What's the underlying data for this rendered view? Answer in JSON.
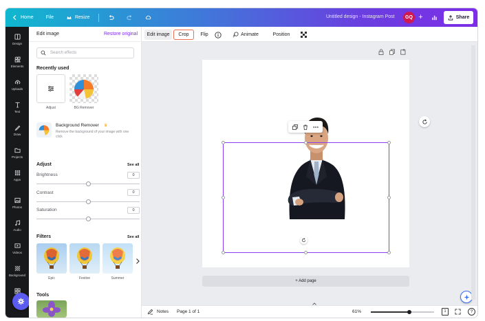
{
  "topbar": {
    "home_label": "Home",
    "file_label": "File",
    "resize_label": "Resize",
    "doc_title": "Untitled design - Instagram Post",
    "avatar_initials": "GQ",
    "share_label": "Share",
    "plus_label": "+"
  },
  "rail": {
    "items": [
      {
        "label": "Design",
        "icon": "design-icon"
      },
      {
        "label": "Elements",
        "icon": "elements-icon"
      },
      {
        "label": "Uploads",
        "icon": "uploads-icon"
      },
      {
        "label": "Text",
        "icon": "text-icon"
      },
      {
        "label": "Draw",
        "icon": "draw-icon"
      },
      {
        "label": "Projects",
        "icon": "projects-icon"
      },
      {
        "label": "Apps",
        "icon": "apps-icon"
      },
      {
        "label": "Photos",
        "icon": "photos-icon"
      },
      {
        "label": "Audio",
        "icon": "audio-icon"
      },
      {
        "label": "Videos",
        "icon": "videos-icon"
      },
      {
        "label": "Background",
        "icon": "background-icon"
      },
      {
        "label": "All",
        "icon": "all-icon"
      }
    ]
  },
  "panel": {
    "title": "Edit image",
    "restore_label": "Restore original",
    "search_placeholder": "Search effects",
    "recently_used_title": "Recently used",
    "recent": [
      {
        "label": "Adjust"
      },
      {
        "label": "BG Remover"
      }
    ],
    "bg_remover": {
      "title": "Background Remover",
      "crown": "♛",
      "description": "Remove the background of your image with one click"
    },
    "adjust": {
      "title": "Adjust",
      "see_all": "See all",
      "sliders": [
        {
          "label": "Brightness",
          "value": "0",
          "level": 0.5
        },
        {
          "label": "Contrast",
          "value": "0",
          "level": 0.5
        },
        {
          "label": "Saturation",
          "value": "0",
          "level": 0.5
        }
      ]
    },
    "filters": {
      "title": "Filters",
      "see_all": "See all",
      "items": [
        {
          "label": "Epic"
        },
        {
          "label": "Festive"
        },
        {
          "label": "Summer"
        }
      ]
    },
    "tools": {
      "title": "Tools"
    }
  },
  "editor_toolbar": {
    "edit_image_label": "Edit image",
    "crop_label": "Crop",
    "flip_label": "Flip",
    "animate_label": "Animate",
    "position_label": "Position"
  },
  "canvas": {
    "add_page_label": "+ Add page"
  },
  "bottom_bar": {
    "notes_label": "Notes",
    "page_label": "Page 1 of 1",
    "zoom_label": "61%",
    "zoom_level": 0.61,
    "page_count_badge": "1"
  },
  "colors": {
    "accent": "#7d2ae8",
    "crop_highlight": "#f06e52",
    "avatar": "#d0194f"
  }
}
